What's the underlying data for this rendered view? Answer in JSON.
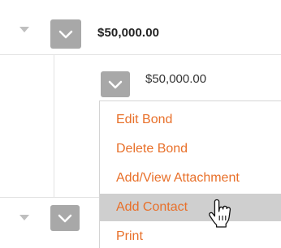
{
  "rows": [
    {
      "amount": "$50,000.00",
      "expanded": true
    },
    {
      "amount": "",
      "expanded": false
    }
  ],
  "detail": {
    "amount": "$50,000.00"
  },
  "menu": {
    "items": [
      {
        "label": "Edit Bond",
        "hovered": false
      },
      {
        "label": "Delete Bond",
        "hovered": false
      },
      {
        "label": "Add/View Attachment",
        "hovered": false
      },
      {
        "label": "Add Contact",
        "hovered": true
      },
      {
        "label": "Print",
        "hovered": false
      }
    ]
  },
  "colors": {
    "menu_text": "#e8702a",
    "menu_hover_bg": "#cfcfcf",
    "button_bg": "#a8a8a8"
  },
  "icons": {
    "expand": "caret-down-icon",
    "action_menu": "chevron-down-icon",
    "cursor": "hand-pointer-cursor-icon"
  }
}
